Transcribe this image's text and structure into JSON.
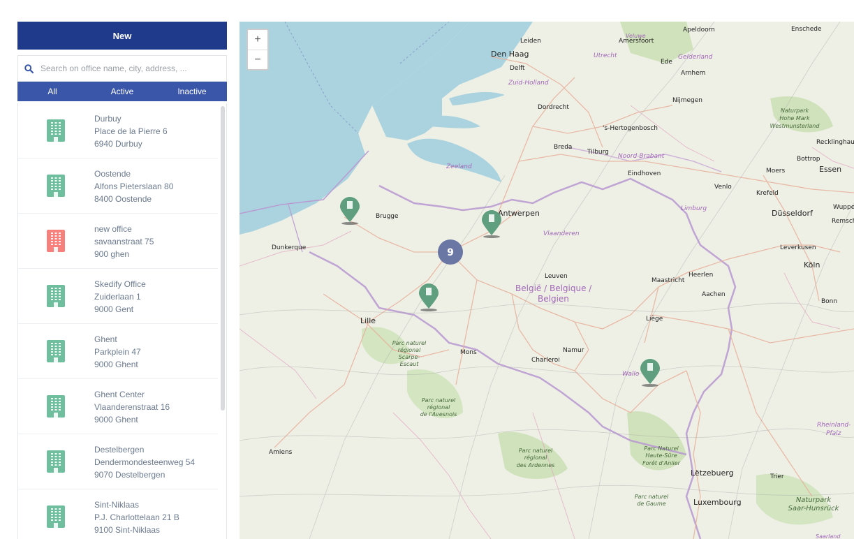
{
  "sidebar": {
    "new_label": "New",
    "search_placeholder": "Search on office name, city, address, ...",
    "tabs": [
      {
        "label": "All"
      },
      {
        "label": "Active"
      },
      {
        "label": "Inactive"
      }
    ],
    "items": [
      {
        "name": "Durbuy",
        "street": "Place de la Pierre 6",
        "city": "6940 Durbuy",
        "status": "active"
      },
      {
        "name": "Oostende",
        "street": "Alfons Pieterslaan 80",
        "city": "8400 Oostende",
        "status": "active"
      },
      {
        "name": "new office",
        "street": "savaanstraat 75",
        "city": "900 ghen",
        "status": "inactive"
      },
      {
        "name": "Skedify Office",
        "street": "Zuiderlaan 1",
        "city": "9000 Gent",
        "status": "active"
      },
      {
        "name": "Ghent",
        "street": "Parkplein 47",
        "city": "9000 Ghent",
        "status": "active"
      },
      {
        "name": "Ghent Center",
        "street": "Vlaanderenstraat 16",
        "city": "9000 Ghent",
        "status": "active"
      },
      {
        "name": "Destelbergen",
        "street": "Dendermondesteenweg 54",
        "city": "9070 Destelbergen",
        "status": "active"
      },
      {
        "name": "Sint-Niklaas",
        "street": "P.J. Charlottelaan 21 B",
        "city": "9100 Sint-Niklaas",
        "status": "active"
      }
    ]
  },
  "colors": {
    "brand": "#1f3a8a",
    "tabs": "#3a56a8",
    "active_icon": "#6fbf9f",
    "inactive_icon": "#f7807c",
    "marker": "#5f9e7f",
    "cluster": "#6a76a3"
  },
  "map": {
    "zoom_in": "+",
    "zoom_out": "−",
    "cluster_count": "9",
    "labels": {
      "den_haag": "Den Haag",
      "leiden": "Leiden",
      "delft": "Delft",
      "zuid_holland": "Zuid-Holland",
      "dordrecht": "Dordrecht",
      "utrecht": "Utrecht",
      "amersfoort": "Amersfoort",
      "apeldoorn": "Apeldoorn",
      "gelderland": "Gelderland",
      "arnhem": "Arnhem",
      "ede": "Ede",
      "nijmegen": "Nijmegen",
      "enschede": "Enschede",
      "hertogenbosch": "'s-Hertogenbosch",
      "breda": "Breda",
      "tilburg": "Tilburg",
      "noord_brabant": "Noord-Brabant",
      "eindhoven": "Eindhoven",
      "zeeland": "Zeeland",
      "antwerpen": "Antwerpen",
      "brugge": "Brugge",
      "dunkerque": "Dunkerque",
      "vlaanderen": "Vlaanderen",
      "belgie_1": "België / Belgique /",
      "belgie_2": "Belgien",
      "leuven": "Leuven",
      "lille": "Lille",
      "mons": "Mons",
      "charleroi": "Charleroi",
      "namur": "Namur",
      "liege": "Liège",
      "maastricht": "Maastricht",
      "heerlen": "Heerlen",
      "aachen": "Aachen",
      "limburg": "Limburg",
      "venlo": "Venlo",
      "krefeld": "Krefeld",
      "moers": "Moers",
      "bottrop": "Bottrop",
      "essen": "Essen",
      "duisseldorf": "Düsseldorf",
      "wuppertal": "Wuppertal",
      "remscheid": "Remscheid",
      "leverkusen": "Leverkusen",
      "koln": "Köln",
      "bonn": "Bonn",
      "recklinghausen": "Recklinghau",
      "np_hohe_mark_1": "Naturpark",
      "np_hohe_mark_2": "Hohe Mark",
      "np_hohe_mark_3": "Westmunsterland",
      "wallonie": "Wallo",
      "pn_scarpe_1": "Parc naturel",
      "pn_scarpe_2": "régional",
      "pn_scarpe_3": "Scarpe-",
      "pn_scarpe_4": "Escaut",
      "pn_avesnois_1": "Parc naturel",
      "pn_avesnois_2": "régional",
      "pn_avesnois_3": "de l'Avesnois",
      "pn_ardennes_1": "Parc naturel",
      "pn_ardennes_2": "régional",
      "pn_ardennes_3": "des Ardennes",
      "pn_haute_sure_1": "Parc Naturel",
      "pn_haute_sure_2": "Haute-Sûre",
      "pn_haute_sure_3": "Forêt d'Anlier",
      "pn_gaume_1": "Parc naturel",
      "pn_gaume_2": "de Gaume",
      "amiens": "Amiens",
      "letzebuerg": "Lëtzebuerg",
      "luxembourg": "Luxembourg",
      "trier": "Trier",
      "rheinland_1": "Rheinland-",
      "rheinland_2": "Pfalz",
      "np_saar_1": "Naturpark",
      "np_saar_2": "Saar-Hunsrück",
      "veluwe": "Veluwe",
      "saarland": "Saarland"
    }
  }
}
